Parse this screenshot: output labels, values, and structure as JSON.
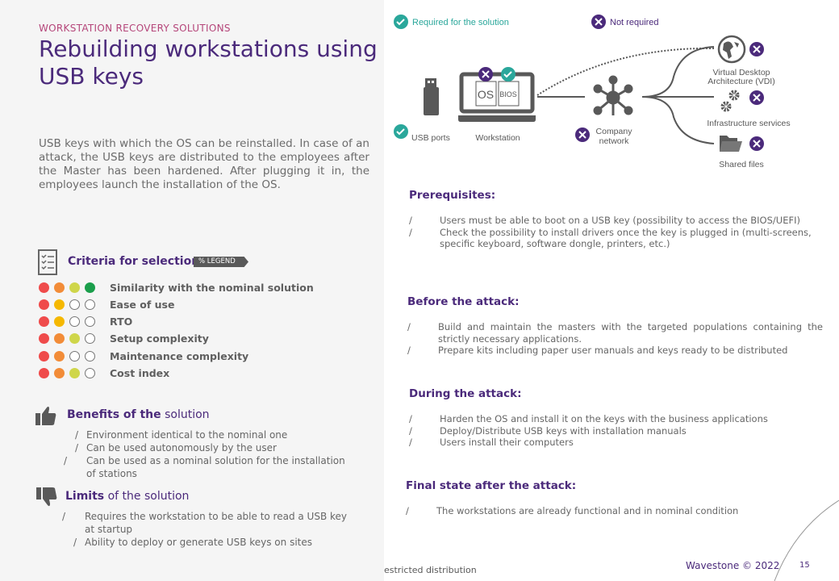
{
  "header": {
    "kicker": "WORKSTATION RECOVERY SOLUTIONS",
    "title": "Rebuilding workstations using USB keys"
  },
  "intro": "USB keys with which the OS can be reinstalled. In case of an attack, the USB keys are distributed to the employees after the Master has been hardened. After plugging it in, the employees launch the installation of the OS.",
  "criteria": {
    "title": "Criteria for selection",
    "legend_label": "LEGEND",
    "level_colors": [
      "#ef4b4b",
      "#f28c38",
      "#cfd64a",
      "#1a9e4b"
    ],
    "rows": [
      {
        "label": "Similarity with the nominal solution",
        "level": 4,
        "colors": [
          "#ef4b4b",
          "#f28c38",
          "#cfd64a",
          "#1a9e4b"
        ]
      },
      {
        "label": "Ease of use",
        "level": 2,
        "colors": [
          "#ef4b4b",
          "#f5b800"
        ]
      },
      {
        "label": "RTO",
        "level": 2,
        "colors": [
          "#ef4b4b",
          "#f5b800"
        ]
      },
      {
        "label": "Setup complexity",
        "level": 3,
        "colors": [
          "#ef4b4b",
          "#f28c38",
          "#cfd64a"
        ]
      },
      {
        "label": "Maintenance complexity",
        "level": 2,
        "colors": [
          "#ef4b4b",
          "#f28c38"
        ]
      },
      {
        "label": "Cost index",
        "level": 3,
        "colors": [
          "#ef4b4b",
          "#f28c38",
          "#cfd64a"
        ]
      }
    ]
  },
  "benefits": {
    "title_bold": "Benefits of the",
    "title_rest": " solution",
    "items": [
      "Environment identical to the nominal one",
      "Can be used autonomously by the user",
      "Can be used as a nominal solution for the installation of stations"
    ]
  },
  "limits": {
    "title_bold": "Limits",
    "title_rest": " of the solution",
    "items": [
      "Requires the workstation to be able to read a USB key at startup",
      "Ability to deploy or generate USB keys on sites"
    ]
  },
  "diagram": {
    "legend_required": "Required for the solution",
    "legend_not_required": "Not required",
    "usb_ports": "USB ports",
    "workstation": "Workstation",
    "os": "OS",
    "bios": "BIOS",
    "network_1": "Company",
    "network_2": "network",
    "vdi_1": "Virtual Desktop",
    "vdi_2": "Architecture (VDI)",
    "infra": "Infrastructure services",
    "shared": "Shared files",
    "colors": {
      "required": "#2aa79b",
      "not_required": "#4b2a7b"
    }
  },
  "sections": [
    {
      "title": "Prerequisites:",
      "items": [
        "Users must be able to boot on a USB key (possibility to access the BIOS/UEFI)",
        "Check the possibility to install drivers once the key is plugged in (multi-screens, specific keyboard, software dongle, printers, etc.)"
      ]
    },
    {
      "title": "Before the attack:",
      "items": [
        "Build and maintain the masters with the targeted populations containing the strictly necessary applications.",
        "Prepare kits including paper user manuals and keys ready to be distributed"
      ]
    },
    {
      "title": "During the attack:",
      "items": [
        "Harden the OS and install it on the keys with the business applications",
        "Deploy/Distribute USB keys with installation manuals",
        "Users install their computers"
      ]
    },
    {
      "title": "Final state after the attack:",
      "items": [
        "The workstations are already functional and in nominal condition"
      ]
    }
  ],
  "footer": {
    "distribution": "estricted distribution",
    "copyright": "Wavestone © 2022",
    "page": "15"
  }
}
